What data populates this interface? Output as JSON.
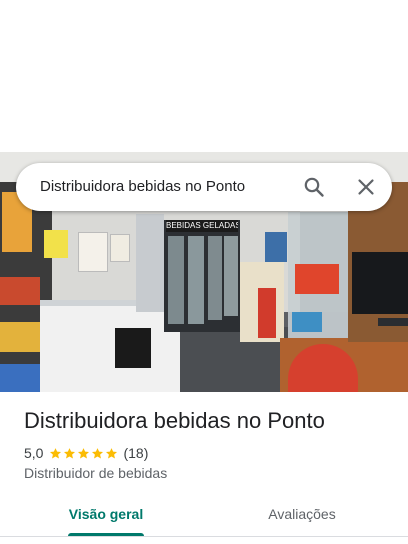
{
  "search": {
    "query": "Distribuidora bebidas no Ponto"
  },
  "place": {
    "name": "Distribuidora bebidas no Ponto",
    "rating": "5,0",
    "rating_value": 5,
    "review_count": "(18)",
    "category": "Distribuidor de bebidas"
  },
  "photo": {
    "fridge_sign": "BEBIDAS GELADAS"
  },
  "tabs": [
    {
      "label": "Visão geral",
      "active": true
    },
    {
      "label": "Avaliações",
      "active": false
    }
  ],
  "colors": {
    "accent": "#00796b",
    "star": "#fbbc04",
    "text_primary": "#202124",
    "text_secondary": "#5f6368"
  },
  "icons": [
    "search-icon",
    "close-icon",
    "star-icon"
  ]
}
